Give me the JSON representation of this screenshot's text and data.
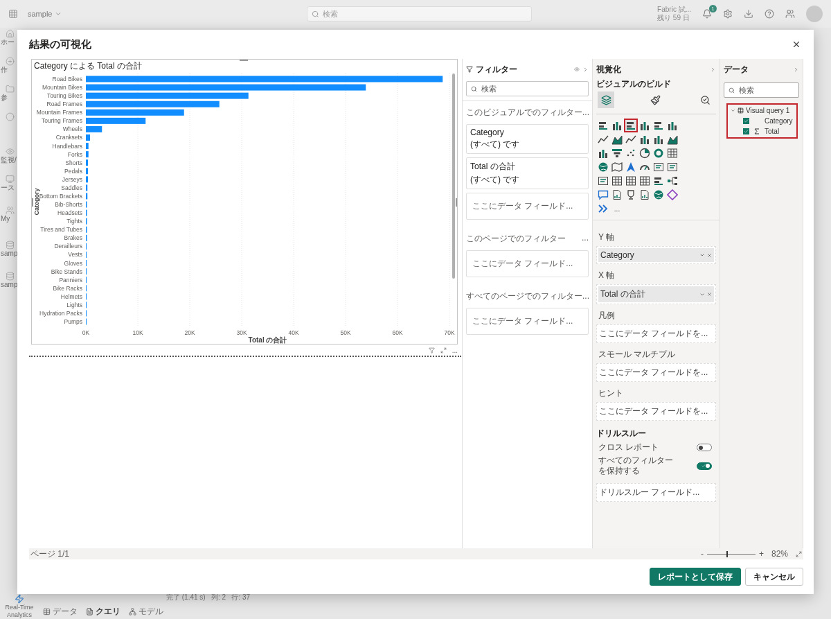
{
  "top_bar": {
    "workspace": "sample",
    "search": {
      "placeholder": "検索"
    },
    "trial": [
      "Fabric 試...",
      "残り 59 日"
    ],
    "notifications": "1"
  },
  "sidebar": {
    "items": [
      {
        "kind": "home",
        "lines": [
          "ホー"
        ]
      },
      {
        "kind": "create",
        "lines": [
          "作"
        ]
      },
      {
        "kind": "browse",
        "lines": [
          "参"
        ]
      },
      {
        "kind": "onelake"
      },
      {
        "kind": "monitor",
        "lines": [
          "監視/"
        ]
      },
      {
        "kind": "workloads",
        "lines": [
          "ース"
        ]
      },
      {
        "kind": "workspace",
        "lines": [
          "My"
        ]
      },
      {
        "kind": "lakehouse",
        "lines": [
          "samp"
        ]
      },
      {
        "kind": "lakehouse",
        "lines": [
          "samp"
        ]
      }
    ],
    "bottom_item": {
      "kind": "realtime",
      "lines": [
        "Real-Time",
        "Analytics"
      ]
    }
  },
  "status_text": "完了 (1.41 s)   列: 2   行: 37",
  "bottom_tabs": [
    {
      "label": "データ",
      "kind": "table",
      "selected": false
    },
    {
      "label": "クエリ",
      "kind": "query",
      "selected": true
    },
    {
      "label": "モデル",
      "kind": "model",
      "selected": false
    }
  ],
  "dialog": {
    "title": "結果の可視化",
    "visual": {
      "chart_data": {
        "type": "bar",
        "orientation": "horizontal",
        "title": "Category による Total の合計",
        "xlabel": "Total の合計",
        "ylabel": "Category",
        "categories": [
          "Road Bikes",
          "Mountain Bikes",
          "Touring Bikes",
          "Road Frames",
          "Mountain Frames",
          "Touring Frames",
          "Wheels",
          "Cranksets",
          "Handlebars",
          "Forks",
          "Shorts",
          "Pedals",
          "Jerseys",
          "Saddles",
          "Bottom Brackets",
          "Bib-Shorts",
          "Headsets",
          "Tights",
          "Tires and Tubes",
          "Brakes",
          "Derailleurs",
          "Vests",
          "Gloves",
          "Bike Stands",
          "Panniers",
          "Bike Racks",
          "Helmets",
          "Lights",
          "Hydration Packs",
          "Pumps"
        ],
        "series": [
          {
            "color": "#118dff",
            "values": [
              68700,
              53900,
              31300,
              25700,
              18900,
              11500,
              3100,
              800,
              500,
              500,
              400,
              400,
              400,
              300,
              300,
              200,
              200,
              200,
              200,
              200,
              100,
              100,
              100,
              100,
              100,
              100,
              100,
              100,
              100,
              100
            ]
          }
        ],
        "xlim": [
          0,
          70000
        ],
        "grid": true,
        "xticks": [
          {
            "value": 0,
            "label": "0K"
          },
          {
            "value": 10000,
            "label": "10K"
          },
          {
            "value": 20000,
            "label": "20K"
          },
          {
            "value": 30000,
            "label": "30K"
          },
          {
            "value": 40000,
            "label": "40K"
          },
          {
            "value": 50000,
            "label": "50K"
          },
          {
            "value": 60000,
            "label": "60K"
          },
          {
            "value": 70000,
            "label": "70K"
          }
        ]
      },
      "footer_more": "..."
    },
    "filters": {
      "title": "フィルター",
      "search": {
        "placeholder": "検索"
      },
      "sections": [
        {
          "title": "このビジュアルでのフィルター...",
          "cards": [
            {
              "kind": "filter",
              "name": "Category",
              "value": "(すべて) です"
            },
            {
              "kind": "filter",
              "name": "Total の合計",
              "value": "(すべて) です"
            },
            {
              "kind": "drop",
              "name": "ここにデータ フィールド..."
            }
          ]
        },
        {
          "title": "このページでのフィルター",
          "more": "...",
          "cards": [
            {
              "kind": "drop",
              "name": "ここにデータ フィールド..."
            }
          ]
        },
        {
          "title": "すべてのページでのフィルター...",
          "cards": [
            {
              "kind": "drop",
              "name": "ここにデータ フィールド..."
            }
          ]
        }
      ]
    },
    "visualizations": {
      "title": "視覚化",
      "subtitle": "ビジュアルのビルド",
      "build_tabs": [
        {
          "kind": "build",
          "selected": true
        },
        {
          "kind": "format",
          "selected": false
        },
        {
          "kind": "analytics",
          "selected": false
        }
      ],
      "gallery": [
        {
          "kind": "hbar",
          "selected": false
        },
        {
          "kind": "col",
          "selected": false
        },
        {
          "kind": "hbar",
          "selected": true
        },
        {
          "kind": "col",
          "selected": false
        },
        {
          "kind": "hbar",
          "selected": false
        },
        {
          "kind": "col",
          "selected": false
        },
        {
          "kind": "line",
          "selected": false
        },
        {
          "kind": "area",
          "selected": false
        },
        {
          "kind": "line",
          "selected": false
        },
        {
          "kind": "col",
          "selected": false
        },
        {
          "kind": "col",
          "selected": false
        },
        {
          "kind": "area",
          "selected": false
        },
        {
          "kind": "col",
          "selected": false
        },
        {
          "kind": "funnel",
          "selected": false
        },
        {
          "kind": "scatter",
          "selected": false
        },
        {
          "kind": "pie",
          "selected": false
        },
        {
          "kind": "donut",
          "selected": false
        },
        {
          "kind": "grid",
          "selected": false
        },
        {
          "kind": "globe",
          "selected": false
        },
        {
          "kind": "map",
          "selected": false
        },
        {
          "kind": "arrow",
          "selected": false
        },
        {
          "kind": "gauge",
          "selected": false
        },
        {
          "kind": "card",
          "selected": false
        },
        {
          "kind": "card",
          "selected": false
        },
        {
          "kind": "card",
          "selected": false
        },
        {
          "kind": "grid",
          "selected": false
        },
        {
          "kind": "grid",
          "selected": false
        },
        {
          "kind": "grid",
          "selected": false
        },
        {
          "kind": "hbar",
          "selected": false
        },
        {
          "kind": "tree",
          "selected": false
        },
        {
          "kind": "bubble",
          "selected": false
        },
        {
          "kind": "doc",
          "selected": false
        },
        {
          "kind": "trophy",
          "selected": false
        },
        {
          "kind": "doc",
          "selected": false
        },
        {
          "kind": "globe",
          "selected": false
        },
        {
          "kind": "diamond",
          "selected": false
        },
        {
          "kind": "chevron",
          "selected": false
        }
      ],
      "gallery_more": "...",
      "wells": [
        {
          "label": "Y 軸",
          "field": "Category"
        },
        {
          "label": "X 軸",
          "field": "Total の合計"
        },
        {
          "label": "凡例",
          "placeholder": "ここにデータ フィールドを..."
        },
        {
          "label": "スモール マルチプル",
          "placeholder": "ここにデータ フィールドを..."
        },
        {
          "label": "ヒント",
          "placeholder": "ここにデータ フィールドを..."
        }
      ],
      "drillthrough": {
        "title": "ドリルスルー",
        "toggles": [
          {
            "label": "クロス レポート",
            "on": false
          },
          {
            "label": "すべてのフィルターを保持する",
            "on": true
          }
        ],
        "placeholder": "ドリルスルー フィールド..."
      }
    },
    "data": {
      "title": "データ",
      "search": {
        "placeholder": "検索"
      },
      "tree": [
        {
          "label": "Visual query 1",
          "expanded": true,
          "children": [
            {
              "label": "Category",
              "kind": "column",
              "checked": true
            },
            {
              "label": "Total",
              "kind": "measure",
              "checked": true
            }
          ]
        }
      ]
    },
    "status": {
      "page": "ページ 1/1",
      "zoom_minus": "-",
      "zoom_plus": "+",
      "zoom_slider": {
        "level": 0.4
      },
      "zoom": "82%"
    },
    "buttons": [
      {
        "label": "レポートとして保存",
        "kind": "primary"
      },
      {
        "label": "キャンセル",
        "kind": "secondary"
      }
    ]
  }
}
